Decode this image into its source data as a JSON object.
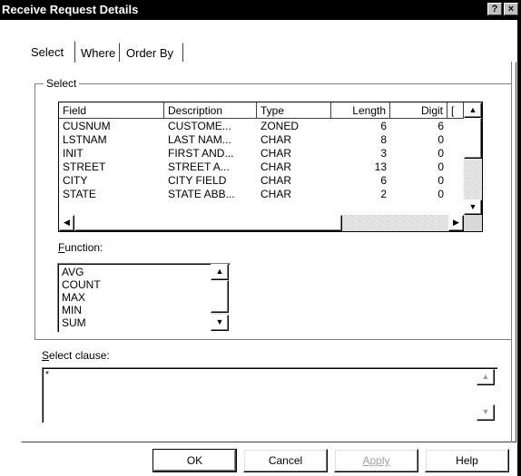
{
  "window": {
    "title": "Receive Request Details",
    "help_button": "?",
    "close_button": "×"
  },
  "tabs": [
    {
      "label": "Select",
      "active": true
    },
    {
      "label": "Where",
      "active": false
    },
    {
      "label": "Order By",
      "active": false
    }
  ],
  "select_group": {
    "label": "Select"
  },
  "fields_table": {
    "columns": [
      "Field",
      "Description",
      "Type",
      "Length",
      "Digit",
      "["
    ],
    "rows": [
      {
        "field": "CUSNUM",
        "description": "CUSTOME...",
        "type": "ZONED",
        "length": "6",
        "digit": "6"
      },
      {
        "field": "LSTNAM",
        "description": "LAST NAM...",
        "type": "CHAR",
        "length": "8",
        "digit": "0"
      },
      {
        "field": "INIT",
        "description": "FIRST AND...",
        "type": "CHAR",
        "length": "3",
        "digit": "0"
      },
      {
        "field": "STREET",
        "description": "STREET A...",
        "type": "CHAR",
        "length": "13",
        "digit": "0"
      },
      {
        "field": "CITY",
        "description": "CITY FIELD",
        "type": "CHAR",
        "length": "6",
        "digit": "0"
      },
      {
        "field": "STATE",
        "description": "STATE ABB...",
        "type": "CHAR",
        "length": "2",
        "digit": "0"
      }
    ]
  },
  "function": {
    "label_prefix": "",
    "label_key": "F",
    "label_rest": "unction:",
    "items": [
      "AVG",
      "COUNT",
      "MAX",
      "MIN",
      "SUM"
    ]
  },
  "select_clause": {
    "label_key": "S",
    "label_rest": "elect clause:",
    "value": "*"
  },
  "buttons": {
    "ok": "OK",
    "cancel": "Cancel",
    "apply": "Apply",
    "help": "Help"
  },
  "scroll_arrows": {
    "up": "▲",
    "down": "▼",
    "left": "◀",
    "right": "▶"
  }
}
